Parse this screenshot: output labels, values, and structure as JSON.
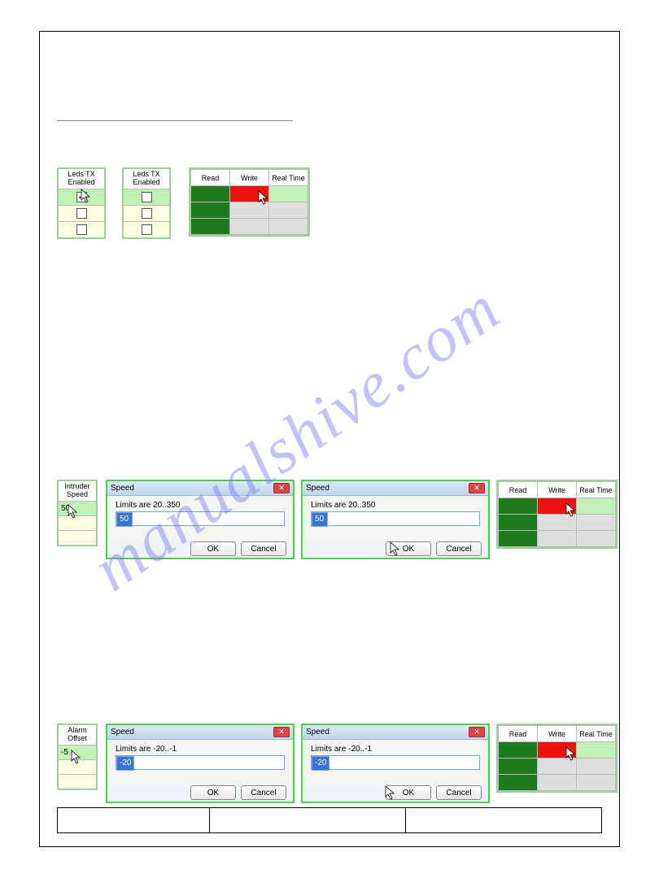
{
  "watermark": "manualshive.com",
  "leds": {
    "title_line1": "Leds TX",
    "title_line2": "Enabled",
    "rows": [
      true,
      false,
      false
    ]
  },
  "rwrt": {
    "headers": [
      "Read",
      "Write",
      "Real Time"
    ]
  },
  "intruder": {
    "title_line1": "Intruder",
    "title_line2": "Speed",
    "value": "50"
  },
  "dialog_speed": {
    "title": "Speed",
    "limits": "Limits are 20..350",
    "value": "50",
    "ok": "OK",
    "cancel": "Cancel"
  },
  "alarm": {
    "title_line1": "Alarm",
    "title_line2": "Offset",
    "value": "-5"
  },
  "dialog_alarm": {
    "title": "Speed",
    "limits": "Limits are -20..-1",
    "value": "-20",
    "ok": "OK",
    "cancel": "Cancel"
  }
}
